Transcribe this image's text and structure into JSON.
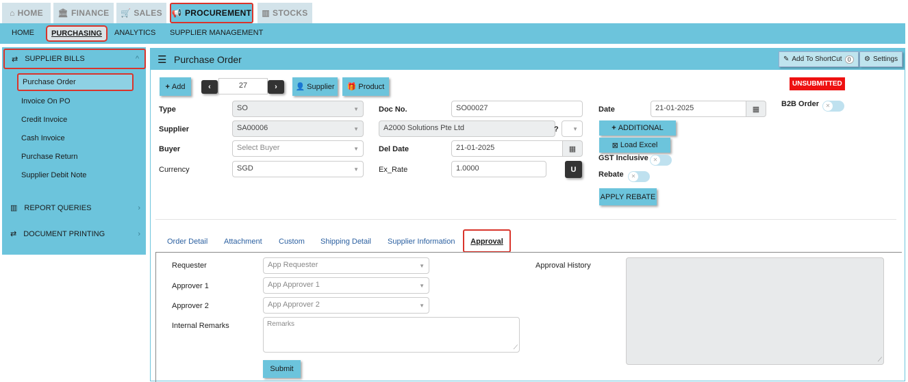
{
  "top_tabs": [
    {
      "icon": "⌂",
      "label": "HOME"
    },
    {
      "icon": "🏛",
      "label": "FINANCE"
    },
    {
      "icon": "🛒",
      "label": "SALES"
    },
    {
      "icon": "📢",
      "label": "PROCUREMENT"
    },
    {
      "icon": "▥",
      "label": "STOCKS"
    }
  ],
  "subnav": [
    "HOME",
    "PURCHASING",
    "ANALYTICS",
    "SUPPLIER MANAGEMENT"
  ],
  "sidebar": {
    "header": "SUPPLIER BILLS",
    "links": [
      "Purchase Order",
      "Invoice On PO",
      "Credit Invoice",
      "Cash Invoice",
      "Purchase Return",
      "Supplier Debit Note"
    ],
    "sections": [
      "REPORT QUERIES",
      "DOCUMENT PRINTING"
    ]
  },
  "main": {
    "title": "Purchase Order",
    "shortcut_label": "Add To ShortCut",
    "shortcut_count": "0",
    "settings_label": "Settings"
  },
  "toolbar": {
    "add_label": "Add",
    "record_number": "27",
    "supplier_label": "Supplier",
    "product_label": "Product"
  },
  "status": "UNSUBMITTED",
  "form": {
    "type_label": "Type",
    "type_value": "SO",
    "supplier_label": "Supplier",
    "supplier_value": "SA00006",
    "buyer_label": "Buyer",
    "buyer_placeholder": "Select Buyer",
    "currency_label": "Currency",
    "currency_value": "SGD",
    "docno_label": "Doc No.",
    "docno_value": "SO00027",
    "supplier_name_value": "A2000 Solutions Pte Ltd",
    "question_mark": "?",
    "deldate_label": "Del Date",
    "deldate_value": "21-01-2025",
    "exrate_label": "Ex_Rate",
    "exrate_value": "1.0000",
    "u_button": "U",
    "date_label": "Date",
    "date_value": "21-01-2025",
    "additional_label": "ADDITIONAL",
    "load_excel_label": "Load Excel",
    "gst_label": "GST Inclusive",
    "rebate_label": "Rebate",
    "apply_rebate_label": "APPLY REBATE",
    "b2b_label": "B2B Order"
  },
  "tabs": [
    "Order Detail",
    "Attachment",
    "Custom",
    "Shipping Detail",
    "Supplier Information",
    "Approval"
  ],
  "approval": {
    "requester_label": "Requester",
    "requester_placeholder": "App Requester",
    "approver1_label": "Approver 1",
    "approver1_placeholder": "App Approver 1",
    "approver2_label": "Approver 2",
    "approver2_placeholder": "App Approver 2",
    "remarks_label": "Internal Remarks",
    "remarks_placeholder": "Remarks",
    "submit_label": "Submit",
    "history_label": "Approval History"
  },
  "colors": {
    "accent": "#6cc4dc",
    "highlight_border": "#d9342b",
    "status_bg": "#ee1111"
  }
}
